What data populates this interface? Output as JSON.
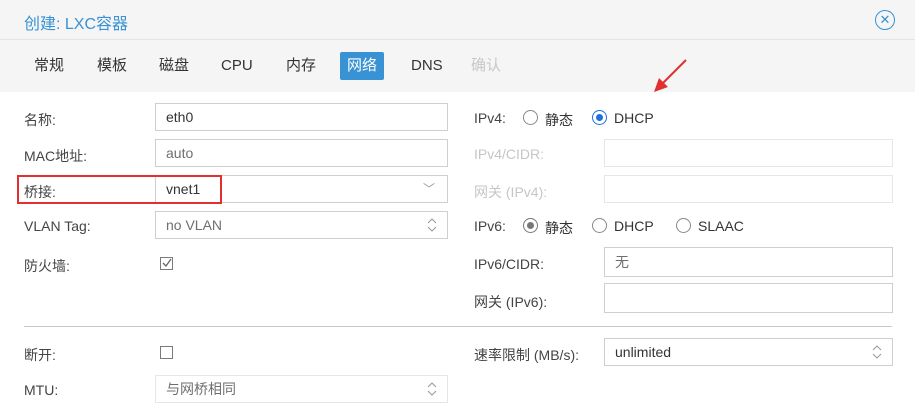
{
  "title": "创建: LXC容器",
  "tabs": [
    "常规",
    "模板",
    "磁盘",
    "CPU",
    "内存",
    "网络",
    "DNS",
    "确认"
  ],
  "left": {
    "name_label": "名称:",
    "name_value": "eth0",
    "mac_label": "MAC地址:",
    "mac_value": "auto",
    "bridge_label": "桥接:",
    "bridge_value": "vnet1",
    "vlan_label": "VLAN Tag:",
    "vlan_value": "no VLAN",
    "firewall_label": "防火墙:",
    "disconnect_label": "断开:",
    "mtu_label": "MTU:",
    "mtu_value": "与网桥相同"
  },
  "right": {
    "ipv4_label": "IPv4:",
    "ipv4_static": "静态",
    "ipv4_dhcp": "DHCP",
    "ipv4_cidr_label": "IPv4/CIDR:",
    "gw4_label": "网关 (IPv4):",
    "ipv6_label": "IPv6:",
    "ipv6_static": "静态",
    "ipv6_dhcp": "DHCP",
    "ipv6_slaac": "SLAAC",
    "ipv6_cidr_label": "IPv6/CIDR:",
    "ipv6_cidr_value": "无",
    "gw6_label": "网关 (IPv6):",
    "rate_label": "速率限制 (MB/s):",
    "rate_value": "unlimited"
  },
  "state": {
    "active_tab": "网络",
    "ipv4_mode": "DHCP",
    "ipv6_mode": "静态",
    "firewall_checked": true,
    "disconnect_checked": false
  },
  "colors": {
    "accent": "#3892d4",
    "annotation": "#e03030"
  }
}
